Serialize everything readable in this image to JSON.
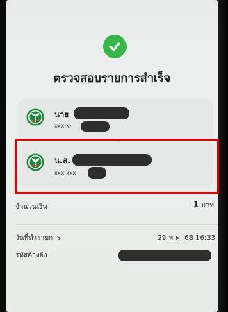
{
  "header": {
    "success_icon": "check-icon",
    "title": "ตรวจสอบรายการสำเร็จ"
  },
  "sender": {
    "name_prefix": "นาย",
    "account": "xxx-x-",
    "bank_logo": "kbank-logo"
  },
  "receiver": {
    "name_prefix": "น.ส.",
    "account": "xxx-xxx",
    "bank_logo": "kbank-logo"
  },
  "details": {
    "amount_label": "จำนวนเงิน",
    "amount_value": "1",
    "amount_unit": "บาท",
    "datetime_label": "วันที่ทำรายการ",
    "datetime_value": "29 พ.ค. 68 16:33",
    "reference_label": "รหัสอ้างอิง"
  },
  "colors": {
    "success_green": "#3ab549",
    "highlight_red": "#e00000",
    "kbank_green": "#1a8a3a",
    "redaction": "#2e2e2e"
  }
}
